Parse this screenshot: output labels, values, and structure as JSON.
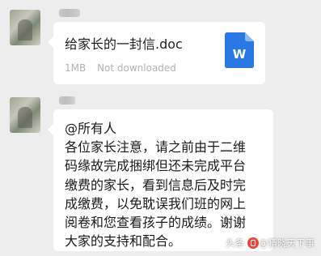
{
  "messages": [
    {
      "type": "file",
      "file_name": "给家长的一封信.doc",
      "file_size": "1MB",
      "file_status": "Not downloaded",
      "file_icon_letter": "W",
      "file_icon_color": "#2b78e4"
    },
    {
      "type": "text",
      "text": "@所有人\n各位家长注意，请之前由于二维\n码缘故完成捆绑但还未完成平台\n缴费的家长，看到信息后及时完\n成缴费，以免耽误我们班的网上\n阅卷和您查看孩子的成绩。谢谢\n大家的支持和配合。"
    }
  ],
  "watermark": {
    "prefix": "头条",
    "account": "@猜晓天下事"
  },
  "colors": {
    "background": "#ededed",
    "bubble": "#ffffff",
    "meta_text": "#b2b2b2"
  }
}
